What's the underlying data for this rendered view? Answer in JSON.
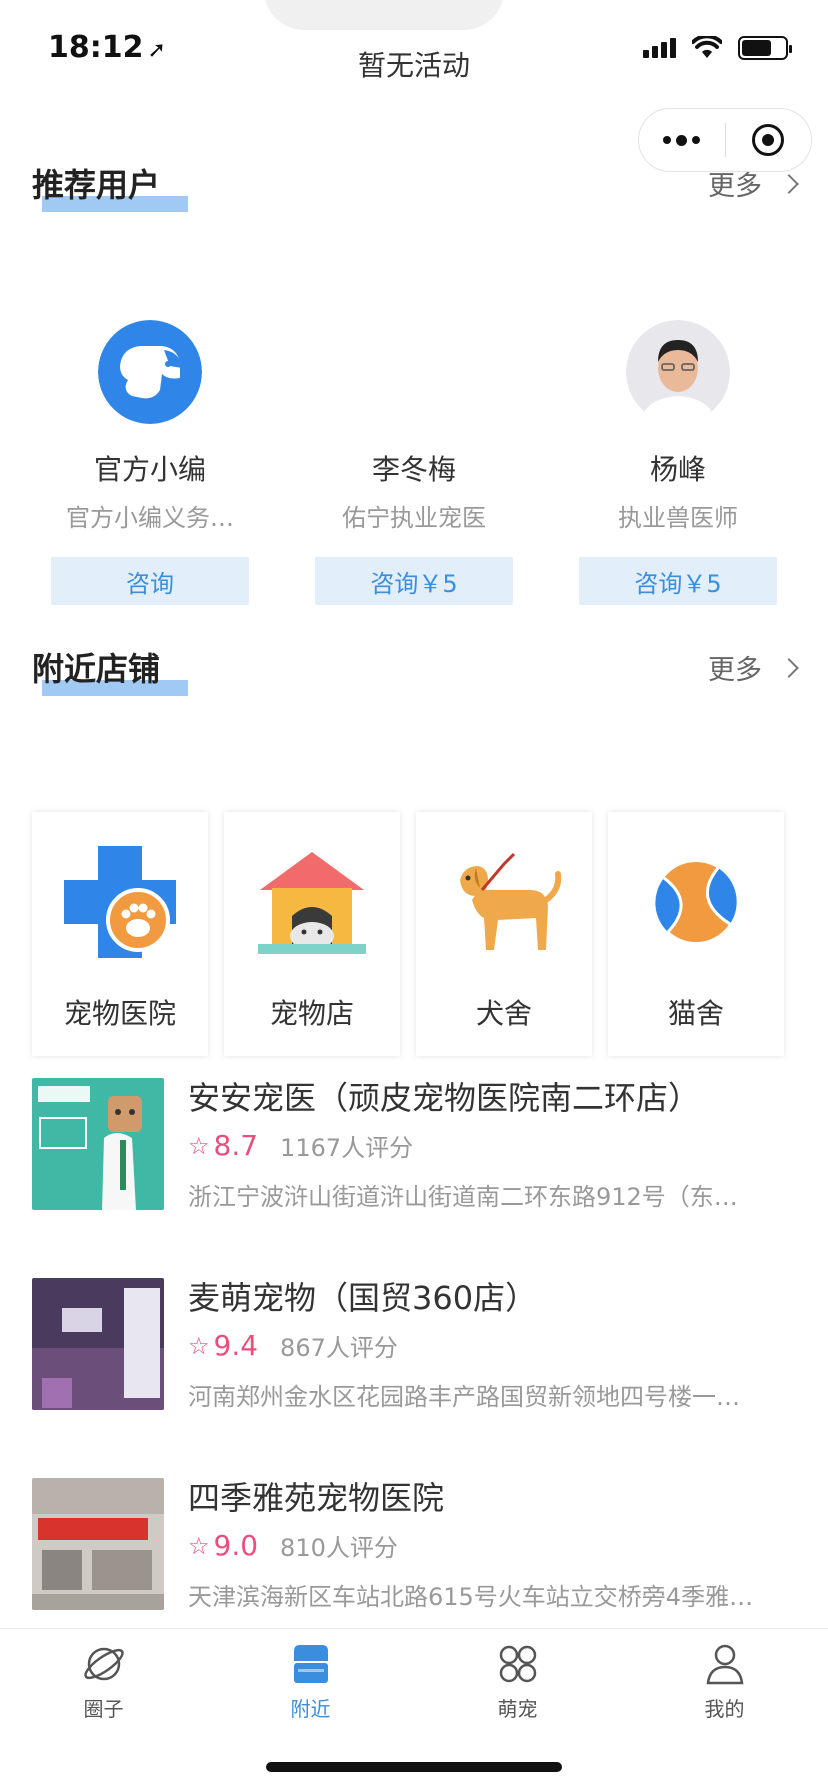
{
  "status_bar": {
    "time": "18:12",
    "nav_title": "暂无活动"
  },
  "recommended": {
    "title": "推荐用户",
    "more": "更多",
    "users": [
      {
        "name": "官方小编",
        "desc": "官方小编义务…",
        "button": "咨询"
      },
      {
        "name": "李冬梅",
        "desc": "佑宁执业宠医",
        "button": "咨询￥5"
      },
      {
        "name": "杨峰",
        "desc": "执业兽医师",
        "button": "咨询￥5"
      }
    ]
  },
  "nearby": {
    "title": "附近店铺",
    "more": "更多",
    "categories": [
      {
        "label": "宠物医院",
        "icon": "pet-hospital-icon"
      },
      {
        "label": "宠物店",
        "icon": "pet-shop-icon"
      },
      {
        "label": "犬舍",
        "icon": "dog-kennel-icon"
      },
      {
        "label": "猫舍",
        "icon": "cattery-icon"
      }
    ],
    "shops": [
      {
        "name": "安安宠医（顽皮宠物医院南二环店）",
        "score": "8.7",
        "reviews": "1167人评分",
        "address": "浙江宁波浒山街道浒山街道南二环东路912号（东…"
      },
      {
        "name": "麦萌宠物（国贸360店）",
        "score": "9.4",
        "reviews": "867人评分",
        "address": "河南郑州金水区花园路丰产路国贸新领地四号楼一…"
      },
      {
        "name": "四季雅苑宠物医院",
        "score": "9.0",
        "reviews": "810人评分",
        "address": "天津滨海新区车站北路615号火车站立交桥旁4季雅…"
      }
    ]
  },
  "tabbar": {
    "tabs": [
      {
        "label": "圈子",
        "icon": "planet-icon"
      },
      {
        "label": "附近",
        "icon": "store-icon"
      },
      {
        "label": "萌宠",
        "icon": "grid-icon"
      },
      {
        "label": "我的",
        "icon": "person-icon"
      }
    ],
    "active_color": "#3b8ede"
  },
  "colors": {
    "accent": "#3b8ede",
    "rating": "#e94f7d",
    "consult_bg": "#e2effb"
  }
}
